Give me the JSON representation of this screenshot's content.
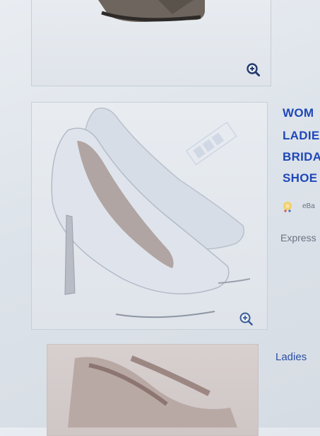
{
  "listings": [
    {
      "title_lines": [],
      "zoom_icon": "magnifier-plus-icon"
    },
    {
      "title_lines": [
        "WOM",
        "LADIE",
        "BRIDA",
        "SHOE"
      ],
      "seller": "eBa",
      "seller_badge_icon": "lightbulb-badge-icon",
      "shipping": "Express",
      "zoom_icon": "magnifier-plus-icon"
    },
    {
      "title": "Ladies"
    }
  ],
  "colors": {
    "link": "#1f48b8",
    "muted": "#6a7282",
    "background": "#e2e7ed"
  }
}
